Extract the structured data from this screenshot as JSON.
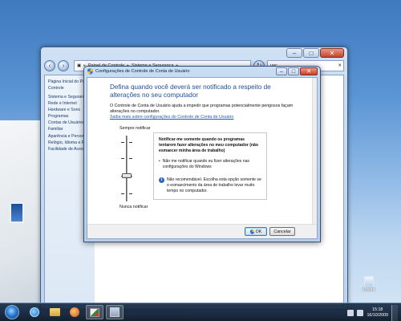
{
  "explorer": {
    "breadcrumb": [
      "Painel de Controle",
      "Sistema e Segurança"
    ],
    "search_value": "uac",
    "sidebar": [
      "Página Inicial do Painel de",
      "Controle",
      "Sistema e Segurança",
      "Rede e Internet",
      "Hardware e Sons",
      "Programas",
      "Contas de Usuários e",
      "Familiar",
      "Aparência e Personalização",
      "Relógio, Idioma e Região",
      "Facilidade de Acesso"
    ]
  },
  "dialog": {
    "title": "Configurações de Controle de Conta de Usuário",
    "heading": "Defina quando você deverá ser notificado a respeito de alterações no seu computador",
    "description": "O Controle de Conta de Usuário ajuda a impedir que programas potencialmente perigosos façam alterações no computador.",
    "link": "Saiba mais sobre configurações do Controle de Conta de Usuário",
    "slider_top_label": "Sempre notificar",
    "slider_bottom_label": "Nunca notificar",
    "slider_level": "2 of 4",
    "info_title": "Notificar-me somente quando os programas tentarem fazer alterações no meu computador (não esmaecer minha área de trabalho)",
    "info_bullet": "Não me notificar quando eu fizer alterações nas configurações do Windows",
    "info_note": "Não recomendável. Escolha esta opção somente se o esmaecimento da área de trabalho levar muito tempo no computador.",
    "ok_label": "OK",
    "cancel_label": "Cancelar"
  },
  "taskbar": {
    "time": "15:18",
    "date": "16/10/2009"
  },
  "desktop": {
    "recycle_bin_label": "Lixeira"
  },
  "colors": {
    "heading": "#1c4e9c",
    "link": "#1d59b9",
    "taskbar": "#1a2e4a"
  }
}
